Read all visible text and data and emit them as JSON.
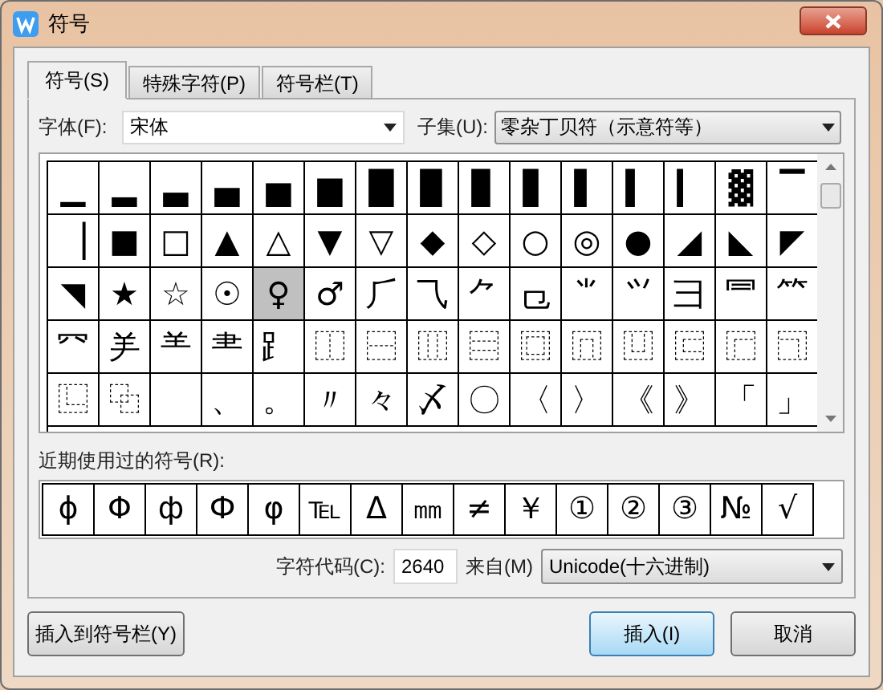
{
  "window": {
    "title": "符号"
  },
  "tabs": [
    {
      "label": "符号(S)",
      "selected": true
    },
    {
      "label": "特殊字符(P)",
      "selected": false
    },
    {
      "label": "符号栏(T)",
      "selected": false
    }
  ],
  "font": {
    "label": "字体(F):",
    "value": "宋体"
  },
  "subset": {
    "label": "子集(U):",
    "value": "零杂丁贝符（示意符等）"
  },
  "symbol_grid": [
    [
      {
        "char": "▁",
        "selected": false
      },
      {
        "char": "▂",
        "selected": false
      },
      {
        "char": "▃",
        "selected": false
      },
      {
        "char": "▄",
        "selected": false
      },
      {
        "char": "▅",
        "selected": false
      },
      {
        "char": "▆",
        "selected": false
      },
      {
        "char": "█",
        "selected": false
      },
      {
        "char": "▉",
        "selected": false
      },
      {
        "char": "▊",
        "selected": false
      },
      {
        "char": "▋",
        "selected": false
      },
      {
        "char": "▌",
        "selected": false
      },
      {
        "char": "▍",
        "selected": false
      },
      {
        "char": "▎",
        "selected": false
      },
      {
        "char": "▓",
        "selected": false
      },
      {
        "char": "▔",
        "selected": false
      }
    ],
    [
      {
        "char": "▕",
        "selected": false
      },
      {
        "char": "■",
        "selected": false
      },
      {
        "char": "□",
        "selected": false
      },
      {
        "char": "▲",
        "selected": false
      },
      {
        "char": "△",
        "selected": false
      },
      {
        "char": "▼",
        "selected": false
      },
      {
        "char": "▽",
        "selected": false
      },
      {
        "char": "◆",
        "selected": false
      },
      {
        "char": "◇",
        "selected": false
      },
      {
        "char": "○",
        "selected": false
      },
      {
        "char": "◎",
        "selected": false
      },
      {
        "char": "●",
        "selected": false
      },
      {
        "char": "◢",
        "selected": false
      },
      {
        "char": "◣",
        "selected": false
      },
      {
        "char": "◤",
        "selected": false
      }
    ],
    [
      {
        "char": "◥",
        "selected": false
      },
      {
        "char": "★",
        "selected": false
      },
      {
        "char": "☆",
        "selected": false
      },
      {
        "char": "☉",
        "selected": false
      },
      {
        "char": "♀",
        "selected": true
      },
      {
        "char": "♂",
        "selected": false
      },
      {
        "char": "⺁",
        "selected": false
      },
      {
        "char": "⺄",
        "selected": false
      },
      {
        "char": "⺈",
        "selected": false
      },
      {
        "char": "⺋",
        "selected": false
      },
      {
        "char": "⺌",
        "selected": false
      },
      {
        "char": "⺍",
        "selected": false
      },
      {
        "char": "⺕",
        "selected": false
      },
      {
        "char": "⺜",
        "selected": false
      },
      {
        "char": "⺮",
        "selected": false
      }
    ],
    [
      {
        "char": "⺳",
        "selected": false
      },
      {
        "char": "⺶",
        "selected": false
      },
      {
        "char": "⺷",
        "selected": false
      },
      {
        "char": "⺻",
        "selected": false
      },
      {
        "char": "⻊",
        "selected": false
      },
      {
        "char": "⿰",
        "selected": false
      },
      {
        "char": "⿱",
        "selected": false
      },
      {
        "char": "⿲",
        "selected": false
      },
      {
        "char": "⿳",
        "selected": false
      },
      {
        "char": "⿴",
        "selected": false
      },
      {
        "char": "⿵",
        "selected": false
      },
      {
        "char": "⿶",
        "selected": false
      },
      {
        "char": "⿷",
        "selected": false
      },
      {
        "char": "⿸",
        "selected": false
      },
      {
        "char": "⿹",
        "selected": false
      }
    ],
    [
      {
        "char": "⿺",
        "selected": false
      },
      {
        "char": "⿻",
        "selected": false
      },
      {
        "selected": false
      },
      {
        "char": "、",
        "selected": false
      },
      {
        "char": "。",
        "selected": false
      },
      {
        "char": "〃",
        "selected": false
      },
      {
        "char": "々",
        "selected": false
      },
      {
        "char": "〆",
        "selected": false
      },
      {
        "char": "〇",
        "selected": false
      },
      {
        "char": "〈",
        "selected": false
      },
      {
        "char": "〉",
        "selected": false
      },
      {
        "char": "《",
        "selected": false
      },
      {
        "char": "》",
        "selected": false
      },
      {
        "char": "「",
        "selected": false
      },
      {
        "char": "」",
        "selected": false
      }
    ]
  ],
  "recent": {
    "label": "近期使用过的符号(R):",
    "symbols": [
      "ɸ",
      "Φ",
      "ф",
      "Ф",
      "φ",
      "℡",
      "Δ",
      "㎜",
      "≠",
      "￥",
      "①",
      "②",
      "③",
      "№",
      "√"
    ]
  },
  "char_code": {
    "label": "字符代码(C):",
    "value": "2640"
  },
  "from": {
    "label": "来自(M)",
    "value": "Unicode(十六进制)"
  },
  "buttons": {
    "insert_to_bar": "插入到符号栏(Y)",
    "insert": "插入(I)",
    "cancel": "取消"
  }
}
